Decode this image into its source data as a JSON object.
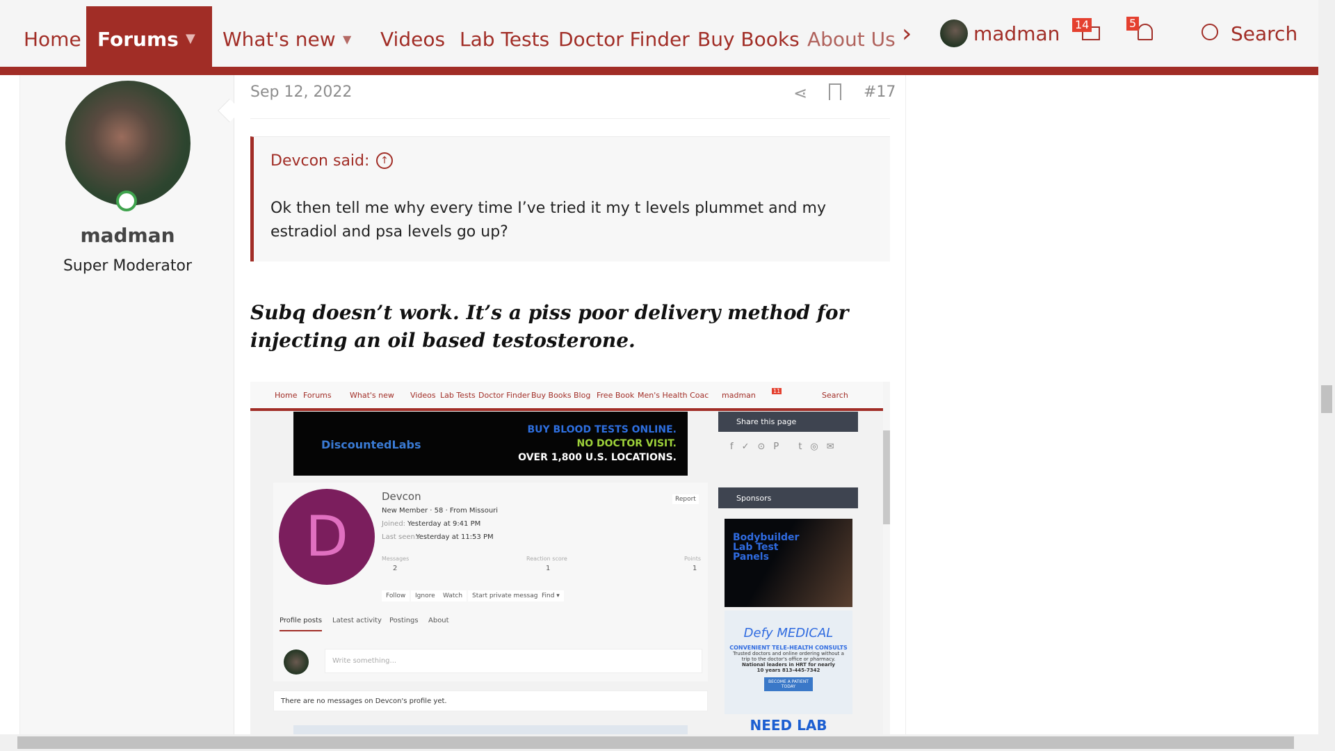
{
  "nav": {
    "items": [
      "Home",
      "Forums",
      "What's new",
      "Videos",
      "Lab Tests",
      "Doctor Finder",
      "Buy Books",
      "About Us"
    ],
    "user": "madman",
    "inbox_count": "14",
    "alerts_count": "5",
    "search": "Search"
  },
  "author": {
    "name": "madman",
    "title": "Super Moderator"
  },
  "post": {
    "date": "Sep 12, 2022",
    "number": "#17",
    "quote": {
      "author": "Devcon said:",
      "text": "Ok then tell me why every time I’ve tried it my t levels plummet and my estradiol and psa levels go up?"
    },
    "body": "Subq doesn’t work. It’s a piss poor delivery method for injecting an oil based testosterone."
  },
  "embedded": {
    "nav": [
      "Home",
      "Forums",
      "What's new",
      "Videos",
      "Lab Tests",
      "Doctor Finder",
      "Buy Books",
      "Blog",
      "Free Book",
      "Men's Health Coac"
    ],
    "user": "madman",
    "inbox_count": "11",
    "search": "Search",
    "banner": {
      "brand": "DiscountedLabs",
      "line1": "BUY BLOOD TESTS ONLINE.",
      "line2": "NO DOCTOR VISIT.",
      "line3": "OVER 1,800 U.S. LOCATIONS."
    },
    "share_title": "Share this page",
    "sponsors_title": "Sponsors",
    "profile": {
      "initial": "D",
      "name": "Devcon",
      "meta": "New Member · 58 · From Missouri",
      "joined_label": "Joined:",
      "joined": "Yesterday at 9:41 PM",
      "seen_label": "Last seen:",
      "seen": "Yesterday at 11:53 PM",
      "report": "Report",
      "stats": [
        {
          "label": "Messages",
          "value": "2"
        },
        {
          "label": "Reaction score",
          "value": "1"
        },
        {
          "label": "Points",
          "value": "1"
        }
      ],
      "buttons": [
        "Follow",
        "Ignore",
        "Watch",
        "Start private message",
        "Find ▾"
      ],
      "tabs": [
        "Profile posts",
        "Latest activity",
        "Postings",
        "About"
      ],
      "write_placeholder": "Write something...",
      "empty": "There are no messages on Devcon's profile yet."
    },
    "ad1": {
      "line": "Bodybuilder Lab Test Panels"
    },
    "ad2": {
      "brand": "Defy MEDICAL",
      "headline": "CONVENIENT TELE-HEALTH CONSULTS",
      "text": "Trusted doctors and online ordering without a trip to the doctor's office or pharmacy.",
      "text2": "National leaders in HRT for nearly 10 years 813-445-7342",
      "cta": "BECOME A PATIENT TODAY"
    },
    "ad3": "NEED LAB TESTS?"
  },
  "colors": {
    "accent": "#a12d26",
    "profile_avatar": "#7b1e5d",
    "sponsor_header": "#3e4450"
  }
}
